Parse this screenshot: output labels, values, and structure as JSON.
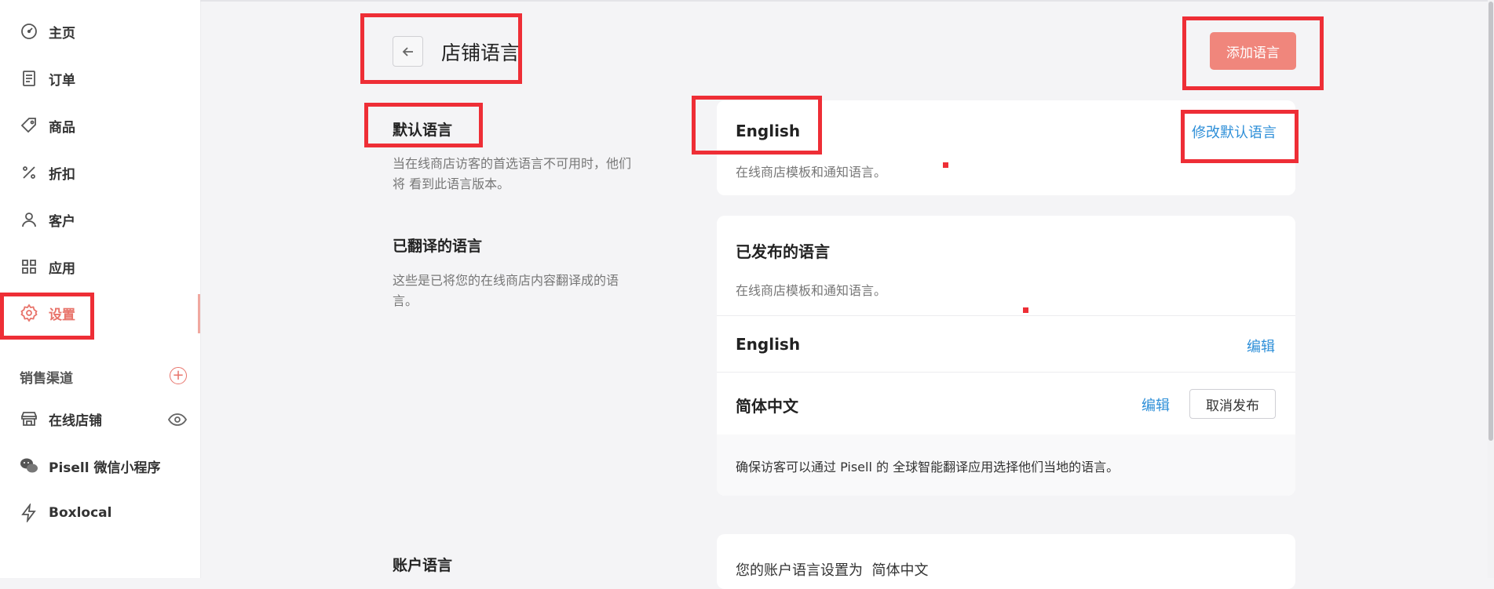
{
  "sidebar": {
    "items": [
      {
        "label": "主页",
        "icon": "dashboard-icon"
      },
      {
        "label": "订单",
        "icon": "receipt-icon"
      },
      {
        "label": "商品",
        "icon": "tag-icon"
      },
      {
        "label": "折扣",
        "icon": "percent-icon"
      },
      {
        "label": "客户",
        "icon": "user-icon"
      },
      {
        "label": "应用",
        "icon": "apps-icon"
      },
      {
        "label": "设置",
        "icon": "gear-icon",
        "active": true
      }
    ],
    "sales_channels_label": "销售渠道",
    "channels": [
      {
        "label": "在线店铺",
        "icon": "store-icon"
      },
      {
        "label": "Pisell 微信小程序",
        "icon": "wechat-icon"
      },
      {
        "label": "Boxlocal",
        "icon": "lightning-icon"
      }
    ]
  },
  "header": {
    "title": "店铺语言",
    "add_button": "添加语言"
  },
  "default_language": {
    "section_title": "默认语言",
    "section_desc_line1": "当在线商店访客的首选语言不可用时，他们",
    "section_desc_line2": "将 看到此语言版本。",
    "card_language": "English",
    "card_desc": "在线商店模板和通知语言。",
    "change_link": "修改默认语言"
  },
  "translated_languages": {
    "section_title": "已翻译的语言",
    "section_desc_line1": "这些是已将您的在线商店内容翻译成的语",
    "section_desc_line2": "言。",
    "card_title": "已发布的语言",
    "card_desc": "在线商店模板和通知语言。",
    "languages": [
      {
        "name": "English",
        "edit": "编辑"
      },
      {
        "name": "简体中文",
        "edit": "编辑",
        "unpublish": "取消发布"
      }
    ],
    "footer_note": "确保访客可以通过 Pisell 的 全球智能翻译应用选择他们当地的语言。"
  },
  "account_language": {
    "section_title": "账户语言",
    "card_text": "您的账户语言设置为  简体中文"
  },
  "colors": {
    "accent": "#e8746b",
    "link": "#2e8fd8",
    "annotation": "#ee2e36"
  }
}
